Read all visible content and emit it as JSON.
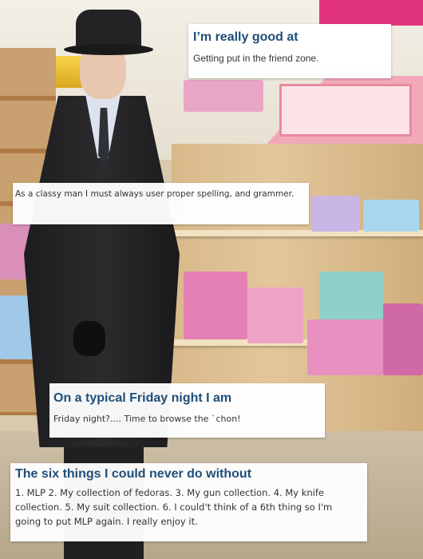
{
  "captions": {
    "good_at": {
      "heading": "I’m really good at",
      "body": "Getting put in the friend zone."
    },
    "classy": {
      "body": "As a classy man I must always user proper spelling, and grammer."
    },
    "friday": {
      "heading": "On a typical Friday night I am",
      "body": "Friday night?.... Time to browse the `chon!"
    },
    "six_things": {
      "heading": "The six things I could never do without",
      "body": "1. MLP 2. My collection of fedoras. 3. My gun collection. 4. My knife collection. 5. My suit collection. 6. I could't think of a 6th thing so I'm going to put MLP again. I really enjoy it."
    }
  },
  "colors": {
    "heading": "#1f4e79",
    "box_bg": "#ffffff",
    "body_text": "#333333"
  }
}
